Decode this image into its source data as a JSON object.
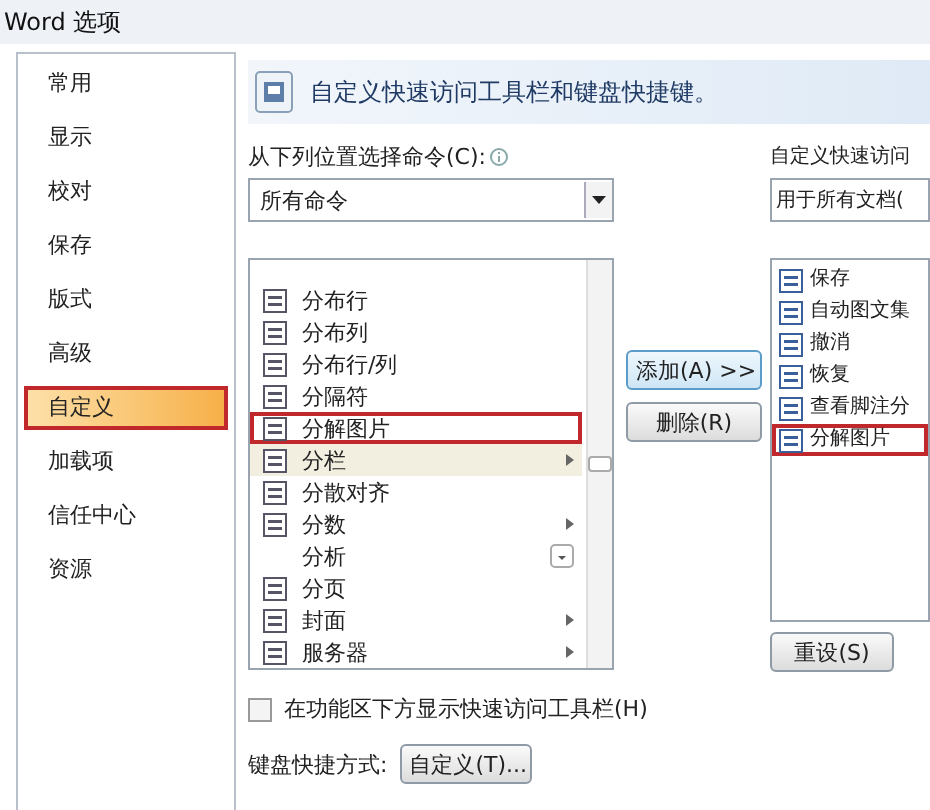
{
  "window": {
    "title": "Word 选项"
  },
  "sidebar": {
    "items": [
      {
        "label": "常用",
        "selected": false,
        "highlighted": false
      },
      {
        "label": "显示",
        "selected": false,
        "highlighted": false
      },
      {
        "label": "校对",
        "selected": false,
        "highlighted": false
      },
      {
        "label": "保存",
        "selected": false,
        "highlighted": false
      },
      {
        "label": "版式",
        "selected": false,
        "highlighted": false
      },
      {
        "label": "高级",
        "selected": false,
        "highlighted": false
      },
      {
        "label": "自定义",
        "selected": true,
        "highlighted": true
      },
      {
        "label": "加载项",
        "selected": false,
        "highlighted": false
      },
      {
        "label": "信任中心",
        "selected": false,
        "highlighted": false
      },
      {
        "label": "资源",
        "selected": false,
        "highlighted": false
      }
    ]
  },
  "header": {
    "title": "自定义快速访问工具栏和键盘快捷键。"
  },
  "commands": {
    "label": "从下列位置选择命令(C):",
    "dropdown": "所有命令",
    "items": [
      {
        "label": "分布行",
        "kind": "plain",
        "has_icon": true,
        "selected": false,
        "highlighted": false
      },
      {
        "label": "分布列",
        "kind": "plain",
        "has_icon": true,
        "selected": false,
        "highlighted": false
      },
      {
        "label": "分布行/列",
        "kind": "plain",
        "has_icon": true,
        "selected": false,
        "highlighted": false
      },
      {
        "label": "分隔符",
        "kind": "plain",
        "has_icon": true,
        "selected": false,
        "highlighted": false
      },
      {
        "label": "分解图片",
        "kind": "plain",
        "has_icon": true,
        "selected": false,
        "highlighted": true
      },
      {
        "label": "分栏",
        "kind": "submenu",
        "has_icon": true,
        "selected": true,
        "highlighted": false
      },
      {
        "label": "分散对齐",
        "kind": "plain",
        "has_icon": true,
        "selected": false,
        "highlighted": false
      },
      {
        "label": "分数",
        "kind": "submenu",
        "has_icon": true,
        "selected": false,
        "highlighted": false
      },
      {
        "label": "分析",
        "kind": "dropdown",
        "has_icon": false,
        "selected": false,
        "highlighted": false
      },
      {
        "label": "分页",
        "kind": "plain",
        "has_icon": true,
        "selected": false,
        "highlighted": false
      },
      {
        "label": "封面",
        "kind": "submenu",
        "has_icon": true,
        "selected": false,
        "highlighted": false
      },
      {
        "label": "服务器",
        "kind": "submenu",
        "has_icon": true,
        "selected": false,
        "highlighted": false
      }
    ],
    "below_ribbon": {
      "label": "在功能区下方显示快速访问工具栏(H)",
      "checked": false
    },
    "shortcut_label": "键盘快捷方式:",
    "shortcut_button": "自定义(T)..."
  },
  "actions": {
    "add": "添加(A) >>",
    "remove": "删除(R)"
  },
  "toolbar": {
    "label": "自定义快速访问",
    "dropdown": "用于所有文档(",
    "items": [
      {
        "label": "保存",
        "highlighted": false
      },
      {
        "label": "自动图文集",
        "highlighted": false
      },
      {
        "label": "撤消",
        "highlighted": false
      },
      {
        "label": "恢复",
        "highlighted": false
      },
      {
        "label": "查看脚注分",
        "highlighted": false
      },
      {
        "label": "分解图片",
        "highlighted": true
      }
    ],
    "reset": "重设(S)"
  }
}
